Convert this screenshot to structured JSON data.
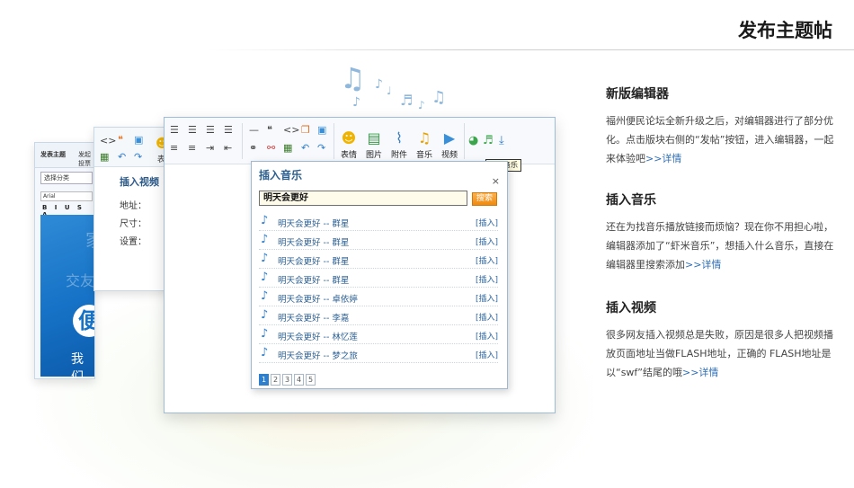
{
  "page_title": "发布主题帖",
  "features": [
    {
      "title": "新版编辑器",
      "desc": "福州便民论坛全新升级之后，对编辑器进行了部分优化。点击版块右侧的“发帖”按钮，进入编辑器，一起来体验吧",
      "more": ">>详情"
    },
    {
      "title": "插入音乐",
      "desc": "还在为找音乐播放链接而烦恼？现在你不用担心啦，编辑器添加了“虾米音乐”，想插入什么音乐，直接在编辑器里搜索添加",
      "more": ">>详情"
    },
    {
      "title": "插入视频",
      "desc": "很多网友插入视频总是失败，原因是很多人把视频播放页面地址当做FLASH地址，正确的 FLASH地址是以“swf”结尾的哦",
      "more": ">>详情"
    }
  ],
  "back_window_1": {
    "tab_active": "发表主题",
    "tab_2": "发起投票",
    "category_select": "选择分类",
    "font_select": "Arial",
    "format_buttons": "B I U S A",
    "banner_text_1": "家",
    "banner_text_2": "交友",
    "banner_logo": "便",
    "banner_text_3": "我们"
  },
  "back_window_2": {
    "partial_label": "表",
    "dialog_title": "插入视频",
    "labels": [
      "地址：",
      "尺寸：",
      "设置："
    ]
  },
  "toolbar": {
    "emoticon": "表情",
    "image": "图片",
    "attachment": "附件",
    "music": "音乐",
    "video": "视频",
    "tooltip": "虾米音乐"
  },
  "music_dialog": {
    "title": "插入音乐",
    "close": "×",
    "search_value": "明天会更好",
    "search_button": "搜索",
    "insert_label": "[插入]",
    "songs": [
      "明天会更好 -- 群星",
      "明天会更好 -- 群星",
      "明天会更好 -- 群星",
      "明天会更好 -- 群星",
      "明天会更好 -- 卓依婷",
      "明天会更好 -- 李嘉",
      "明天会更好 -- 林忆莲",
      "明天会更好 -- 梦之旅"
    ],
    "pages": [
      "1",
      "2",
      "3",
      "4",
      "5"
    ],
    "current_page": "1"
  },
  "colors": {
    "accent_blue": "#2f7fcf",
    "link_blue": "#2f6fb6",
    "search_button": "#ef8a10"
  }
}
